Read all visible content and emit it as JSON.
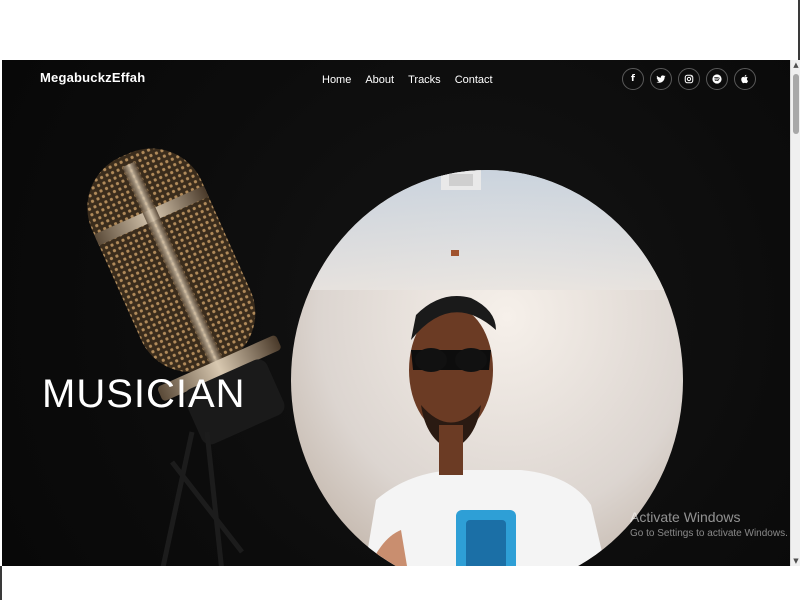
{
  "site": {
    "brand": "MegabuckzEffah"
  },
  "nav": {
    "items": [
      {
        "label": "Home"
      },
      {
        "label": "About"
      },
      {
        "label": "Tracks"
      },
      {
        "label": "Contact"
      }
    ]
  },
  "social": {
    "icons": [
      {
        "name": "facebook-icon",
        "glyph": "f"
      },
      {
        "name": "twitter-icon",
        "glyph": "🐦"
      },
      {
        "name": "instagram-icon",
        "glyph": "◎"
      },
      {
        "name": "spotify-icon",
        "glyph": "≋"
      },
      {
        "name": "apple-icon",
        "glyph": ""
      }
    ]
  },
  "hero": {
    "headline": "MUSICIAN"
  },
  "watermark": {
    "title": "Activate Windows",
    "subtitle": "Go to Settings to activate Windows."
  },
  "colors": {
    "hero_bg": "#0c0c0c",
    "text": "#ffffff",
    "icon_border": "#5a5a5a",
    "mic_gold": "#b08a5a"
  }
}
